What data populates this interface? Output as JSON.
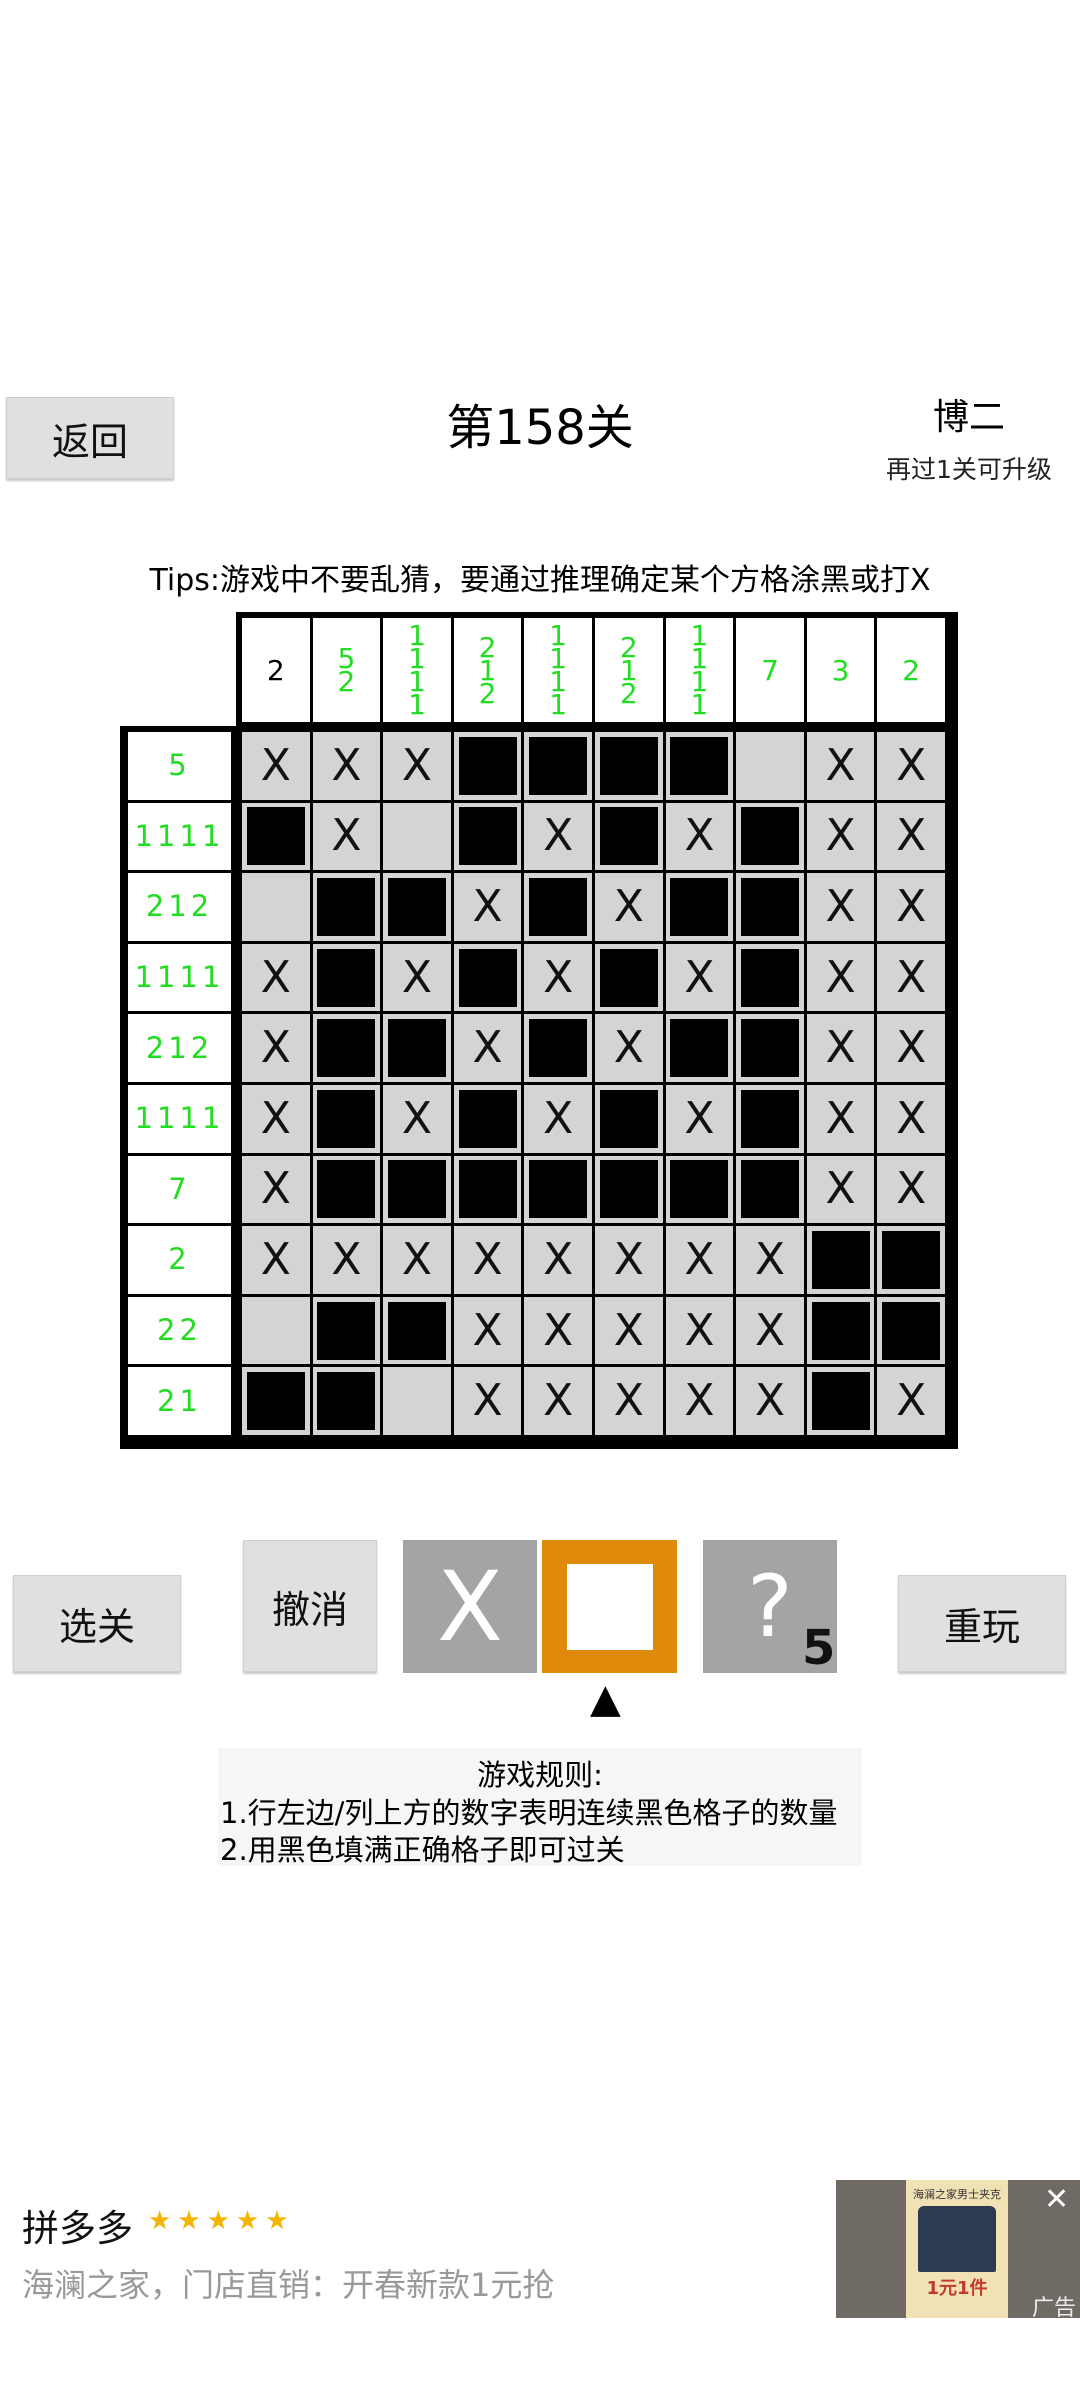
{
  "header": {
    "back_label": "返回",
    "level_title": "第158关",
    "rank": "博二",
    "rank_progress": "再过1关可升级"
  },
  "tips": "Tips:游戏中不要乱猜，要通过推理确定某个方格涂黑或打X",
  "puzzle": {
    "column_clues": [
      {
        "lines": [
          "2"
        ],
        "completed": false
      },
      {
        "lines": [
          "5",
          "2"
        ],
        "completed": true
      },
      {
        "lines": [
          "1",
          "1",
          "1",
          "1"
        ],
        "completed": true
      },
      {
        "lines": [
          "2",
          "1",
          "2"
        ],
        "completed": true
      },
      {
        "lines": [
          "1",
          "1",
          "1",
          "1"
        ],
        "completed": true
      },
      {
        "lines": [
          "2",
          "1",
          "2"
        ],
        "completed": true
      },
      {
        "lines": [
          "1",
          "1",
          "1",
          "1"
        ],
        "completed": true
      },
      {
        "lines": [
          "7"
        ],
        "completed": true
      },
      {
        "lines": [
          "3"
        ],
        "completed": true
      },
      {
        "lines": [
          "2"
        ],
        "completed": true
      }
    ],
    "row_clues": [
      "5",
      "1111",
      "212",
      "1111",
      "212",
      "1111",
      "7",
      "2",
      "22",
      "21"
    ],
    "grid": [
      "XXX####.XX",
      "#X_#X#X#XX",
      "_##X#X##XX",
      "X#X#X#X#XX",
      "X##X#X##XX",
      "X#X#X#X#XX",
      "X#######XX",
      "XXXXXXXX##",
      "_##XXXXX##",
      "##_XXXXX#X"
    ],
    "cell_x_glyph": "X"
  },
  "toolbar": {
    "select_level_label": "选关",
    "undo_label": "撤消",
    "replay_label": "重玩",
    "x_tool_glyph": "X",
    "hint_glyph": "?",
    "hint_count": "5",
    "selected_tool": "fill",
    "selected_marker": "▲",
    "colors": {
      "tool_gray": "#a4a4a4",
      "tool_selected": "#e08a0c",
      "clue_done": "#22dd22"
    }
  },
  "rules": {
    "title": "游戏规则:",
    "line1": "1.行左边/列上方的数字表明连续黑色格子的数量",
    "line2": "2.用黑色填满正确格子即可过关"
  },
  "ad": {
    "brand": "拼多多",
    "stars": "★★★★★",
    "rating": 5,
    "text": "海澜之家，门店直销：开春新款1元抢",
    "image_headline": "海澜之家男士夹克",
    "image_price": "1元1件",
    "close_glyph": "✕",
    "label": "广告"
  }
}
